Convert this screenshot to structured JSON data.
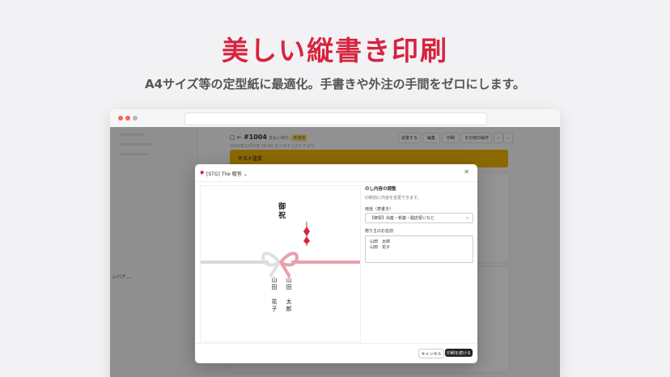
{
  "hero": {
    "title": "美しい縦書き印刷",
    "subtitle": "A4サイズ等の定型紙に最適化。手書きや外注の手間をゼロにします。"
  },
  "app": {
    "order": {
      "number": "#1004",
      "status": "支払い待ち",
      "badge": "未発送",
      "sub": "2024年12月5日 19:34 オンラインストアより"
    },
    "toolbar": {
      "refund": "返金する",
      "edit": "編集",
      "print": "印刷",
      "more": "その他の操作"
    },
    "banner": "テスト注文",
    "sidebar_label": "ンバナ..."
  },
  "modal": {
    "title": "[STG] The 贈答",
    "close_icon": "close-icon",
    "panel": {
      "heading": "のし内容の調整",
      "help": "印刷前に内容を変更できます。",
      "purpose_label": "用途（表書き）",
      "purpose_value": "【御祝】出産・新築・開店祝いなど",
      "names_label": "贈り主のお名前",
      "names": [
        "山田　太郎",
        "山田　花子"
      ]
    },
    "preview": {
      "omote": "御祝",
      "name1": "山田　太郎",
      "name2": "山田　花子"
    },
    "cancel_label": "キャンセル",
    "print_label": "印刷を続ける"
  },
  "colors": {
    "accent": "#d6243e",
    "banner": "#f2b600",
    "mizuhiki_red": "#e8a0ad"
  }
}
